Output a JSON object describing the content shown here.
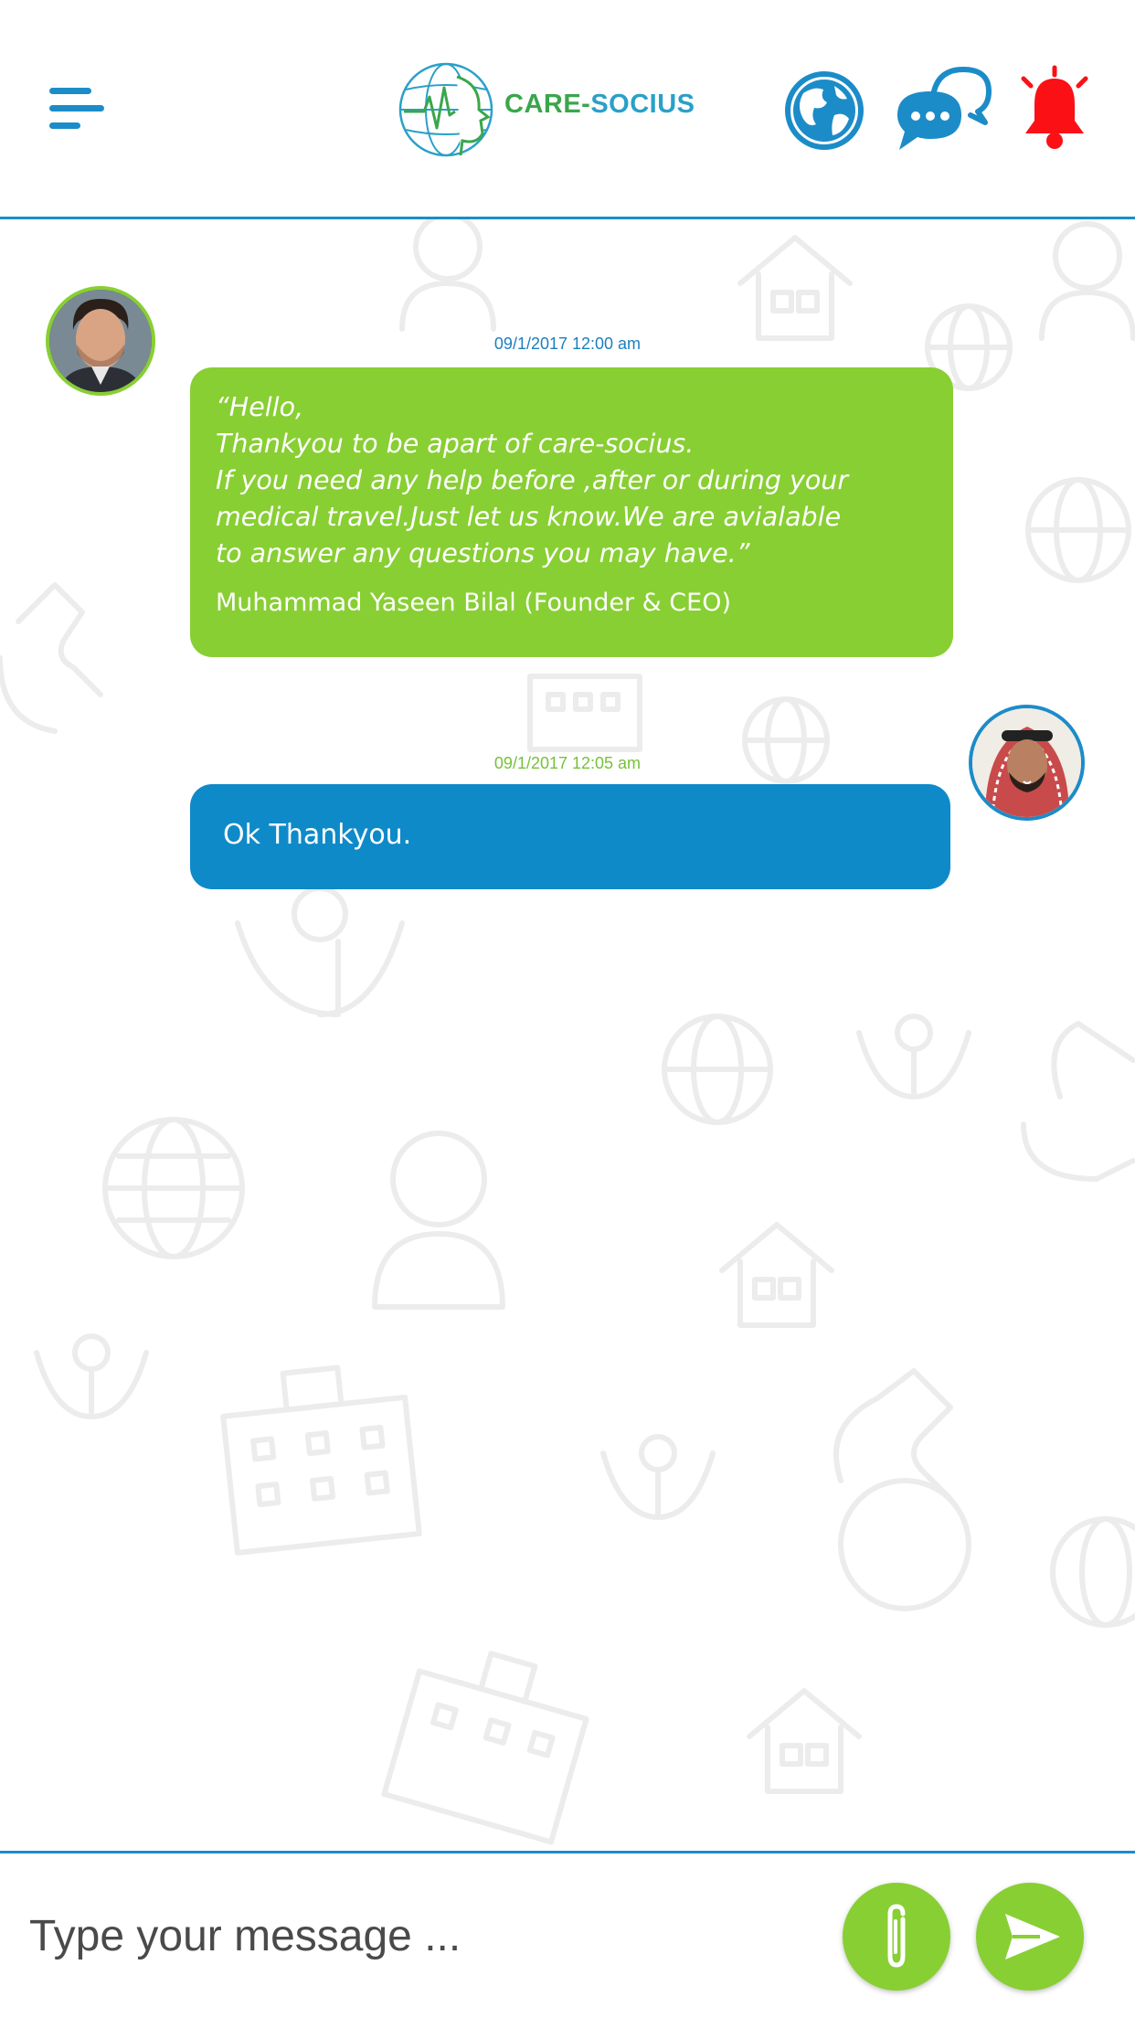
{
  "header": {
    "brand_prefix": "CARE-",
    "brand_suffix": "SOCIUS",
    "icons": [
      "menu-icon",
      "globe-icon",
      "chat-bubbles-icon",
      "bell-icon"
    ]
  },
  "messages": [
    {
      "sender": "other",
      "timestamp": "09/1/2017 12:00 am",
      "text": "“Hello,\nThankyou to be apart of care-socius.\nIf you need any help before ,after or during your\nmedical travel.Just let us know.We are avialable\nto answer any questions you may have.”",
      "signature": "Muhammad Yaseen Bilal (Founder & CEO)",
      "bubble_color": "#88cf33"
    },
    {
      "sender": "me",
      "timestamp": "09/1/2017 12:05 am",
      "text": "Ok Thankyou.",
      "bubble_color": "#0f8ac9"
    }
  ],
  "composer": {
    "placeholder": "Type your message ...",
    "value": ""
  },
  "colors": {
    "primary_blue": "#1c8cc8",
    "accent_green": "#88cf33",
    "alert_red": "#fb1016"
  }
}
